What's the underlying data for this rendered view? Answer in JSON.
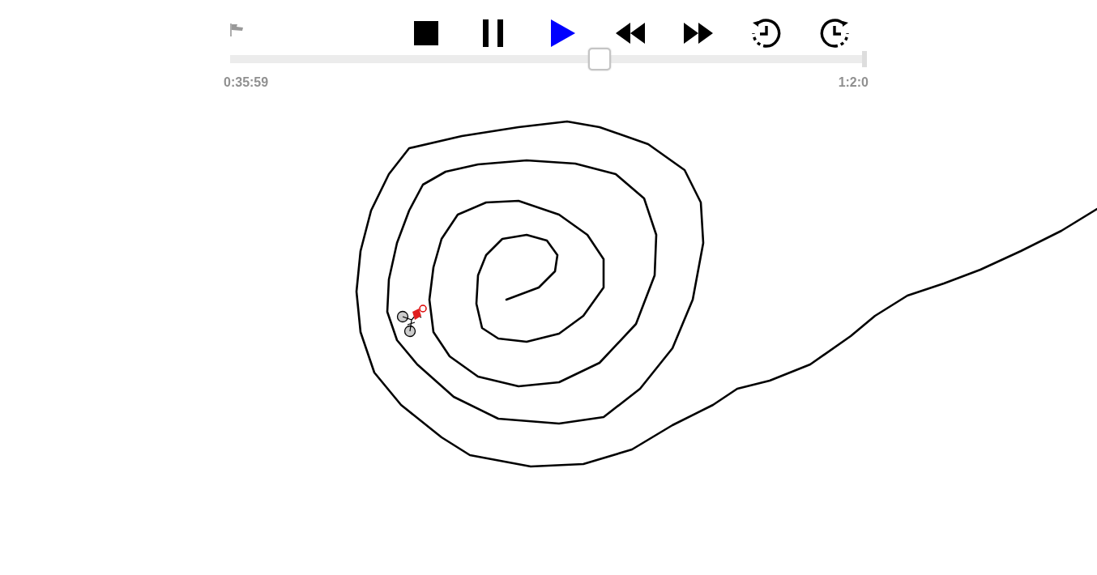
{
  "player": {
    "buttons": [
      {
        "kind": "stop",
        "selected": false
      },
      {
        "kind": "pause",
        "selected": false
      },
      {
        "kind": "play",
        "selected": true
      },
      {
        "kind": "rewind",
        "selected": false
      },
      {
        "kind": "fast_forward",
        "selected": false
      },
      {
        "kind": "step_back",
        "selected": false
      },
      {
        "kind": "step_forward",
        "selected": false
      }
    ],
    "timeline": {
      "level": 0.58,
      "start_time": "0:35:59",
      "end_time": "1:2:0"
    }
  }
}
